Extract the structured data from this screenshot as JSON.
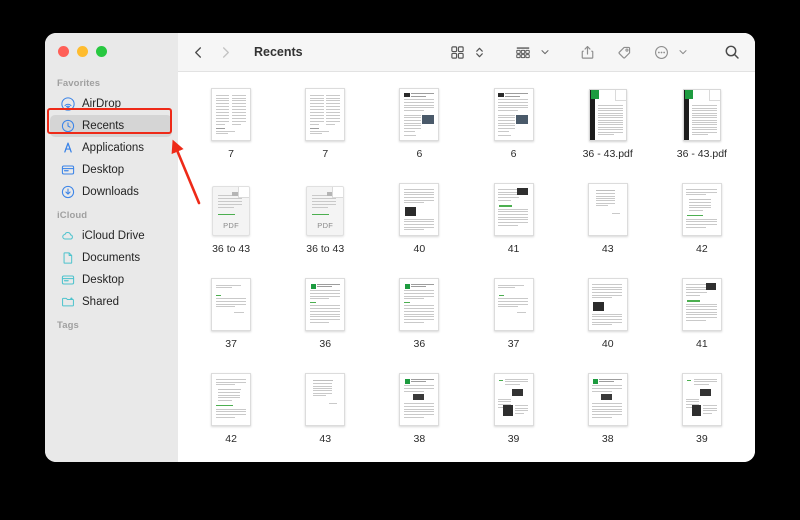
{
  "window": {
    "title": "Recents",
    "traffic_lights": [
      {
        "name": "close",
        "color": "#ff5f57"
      },
      {
        "name": "minimize",
        "color": "#febc2e"
      },
      {
        "name": "maximize",
        "color": "#28c840"
      }
    ]
  },
  "toolbar": {
    "back_label": "Back",
    "forward_label": "Forward",
    "title": "Recents",
    "buttons": [
      {
        "name": "icon-view",
        "icon": "grid-view-icon",
        "label": "Icon View"
      },
      {
        "name": "view-stepper",
        "icon": "chevron-up-down-icon",
        "label": "View Options"
      },
      {
        "name": "group-by",
        "icon": "group-by-icon",
        "label": "Group"
      },
      {
        "name": "group-by-chevron",
        "icon": "chevron-down-icon",
        "label": "Group Options"
      },
      {
        "name": "share",
        "icon": "share-icon",
        "label": "Share"
      },
      {
        "name": "tag",
        "icon": "tag-icon",
        "label": "Tags"
      },
      {
        "name": "more",
        "icon": "ellipsis-circle-icon",
        "label": "More"
      },
      {
        "name": "more-chevron",
        "icon": "chevron-down-icon",
        "label": "More Options"
      },
      {
        "name": "search",
        "icon": "search-icon",
        "label": "Search"
      }
    ]
  },
  "sidebar": {
    "sections": [
      {
        "title": "Favorites",
        "items": [
          {
            "label": "AirDrop",
            "icon": "airdrop-icon",
            "selected": false
          },
          {
            "label": "Recents",
            "icon": "clock-icon",
            "selected": true
          },
          {
            "label": "Applications",
            "icon": "applications-icon",
            "selected": false
          },
          {
            "label": "Desktop",
            "icon": "desktop-icon",
            "selected": false
          },
          {
            "label": "Downloads",
            "icon": "downloads-icon",
            "selected": false
          }
        ]
      },
      {
        "title": "iCloud",
        "items": [
          {
            "label": "iCloud Drive",
            "icon": "cloud-icon",
            "selected": false
          },
          {
            "label": "Documents",
            "icon": "document-icon",
            "selected": false
          },
          {
            "label": "Desktop",
            "icon": "desktop-icon",
            "selected": false
          },
          {
            "label": "Shared",
            "icon": "shared-folder-icon",
            "selected": false
          }
        ]
      },
      {
        "title": "Tags",
        "items": []
      }
    ],
    "accent_color": "#3b84e8",
    "icloud_color": "#4ec3cd"
  },
  "files": [
    {
      "name": "7",
      "kind": "doc-two-column"
    },
    {
      "name": "7",
      "kind": "doc-two-column"
    },
    {
      "name": "6",
      "kind": "doc-header-image"
    },
    {
      "name": "6",
      "kind": "doc-header-image"
    },
    {
      "name": "36 - 43.pdf",
      "kind": "pdf-dark-spine"
    },
    {
      "name": "36 - 43.pdf",
      "kind": "pdf-dark-spine"
    },
    {
      "name": "36 to 43",
      "kind": "pdf-label"
    },
    {
      "name": "36 to 43",
      "kind": "pdf-label"
    },
    {
      "name": "40",
      "kind": "doc-dark-figure"
    },
    {
      "name": "41",
      "kind": "doc-sketch-figure"
    },
    {
      "name": "43",
      "kind": "doc-table"
    },
    {
      "name": "42",
      "kind": "doc-table-green"
    },
    {
      "name": "37",
      "kind": "doc-sparse"
    },
    {
      "name": "36",
      "kind": "doc-green-badge"
    },
    {
      "name": "36",
      "kind": "doc-green-badge"
    },
    {
      "name": "37",
      "kind": "doc-sparse"
    },
    {
      "name": "40",
      "kind": "doc-dark-figure"
    },
    {
      "name": "41",
      "kind": "doc-sketch-figure"
    },
    {
      "name": "42",
      "kind": "doc-table-green"
    },
    {
      "name": "43",
      "kind": "doc-table"
    },
    {
      "name": "38",
      "kind": "doc-equation-badge"
    },
    {
      "name": "39",
      "kind": "doc-photo"
    },
    {
      "name": "38",
      "kind": "doc-equation-badge"
    },
    {
      "name": "39",
      "kind": "doc-photo"
    }
  ],
  "annotations": {
    "highlight_target": "Recents",
    "highlight_color": "#ee2a18",
    "arrow_color": "#ee2a18"
  }
}
